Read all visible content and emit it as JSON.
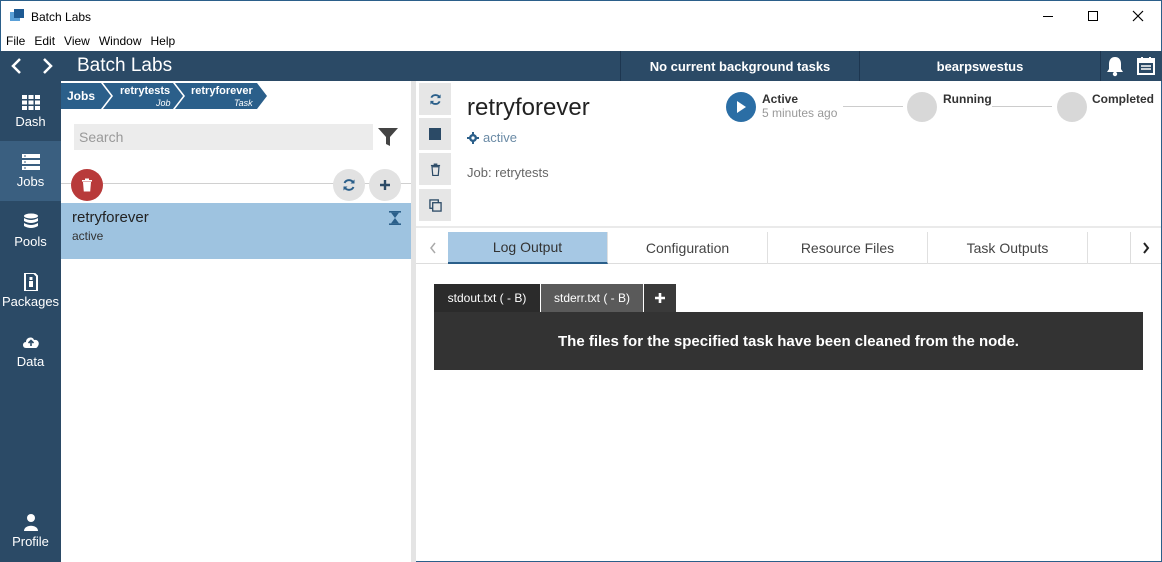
{
  "window": {
    "title": "Batch Labs"
  },
  "menu": {
    "items": [
      "File",
      "Edit",
      "View",
      "Window",
      "Help"
    ]
  },
  "header": {
    "app_title": "Batch Labs",
    "background_tasks": "No current background tasks",
    "account": "bearpswestus"
  },
  "nav": {
    "items": [
      {
        "label": "Dash",
        "icon": "dashboard-icon"
      },
      {
        "label": "Jobs",
        "icon": "jobs-icon",
        "active": true
      },
      {
        "label": "Pools",
        "icon": "pools-icon"
      },
      {
        "label": "Packages",
        "icon": "packages-icon"
      },
      {
        "label": "Data",
        "icon": "cloud-upload-icon"
      }
    ],
    "profile_label": "Profile"
  },
  "breadcrumb": {
    "items": [
      {
        "title": "Jobs",
        "subtitle": ""
      },
      {
        "title": "retrytests",
        "subtitle": "Job"
      },
      {
        "title": "retryforever",
        "subtitle": "Task"
      }
    ]
  },
  "list": {
    "search_placeholder": "Search",
    "items": [
      {
        "name": "retryforever",
        "state": "active"
      }
    ]
  },
  "detail": {
    "title": "retryforever",
    "state": "active",
    "job_label": "Job: retrytests",
    "progress": [
      {
        "label": "Active",
        "sub": "5 minutes ago"
      },
      {
        "label": "Running",
        "sub": ""
      },
      {
        "label": "Completed",
        "sub": ""
      }
    ],
    "tabs": [
      "Log Output",
      "Configuration",
      "Resource Files",
      "Task Outputs"
    ],
    "active_tab": "Log Output",
    "file_tabs": [
      "stdout.txt ( - B)",
      "stderr.txt ( - B)"
    ],
    "active_file_tab": "stdout.txt ( - B)",
    "log_message": "The files for the specified task have been cleaned from the node."
  },
  "colors": {
    "nav_bg": "#2b4a66",
    "accent": "#2b5f8a",
    "selected_row": "#9ec3e0",
    "delete": "#b83a3a"
  }
}
